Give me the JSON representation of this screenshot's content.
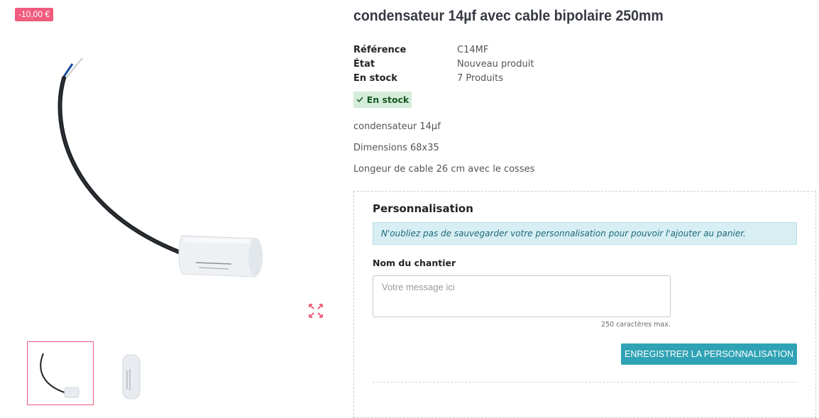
{
  "product": {
    "discount_badge": "-10,00 €",
    "title": "condensateur 14µf avec cable bipolaire 250mm"
  },
  "specs": [
    {
      "label": "Référence",
      "value": "C14MF"
    },
    {
      "label": "État",
      "value": "Nouveau produit"
    },
    {
      "label": "En stock",
      "value": "7 Produits"
    }
  ],
  "stock_status": "En stock",
  "description": [
    "condensateur 14µf",
    "Dimensions 68x35",
    "Longeur de cable 26 cm avec le cosses"
  ],
  "personalization": {
    "title": "Personnalisation",
    "notice": "N'oubliez pas de sauvegarder votre personnalisation pour pouvoir l'ajouter au panier.",
    "field_label": "Nom du chantier",
    "placeholder": "Votre message ici",
    "char_limit": "250 caractères max.",
    "save_button": "Enregistrer la personnalisation"
  },
  "icons": {
    "expand": "expand-icon",
    "check": "check-icon"
  },
  "colors": {
    "badge": "#f15c7e",
    "button": "#2fa3b5",
    "stock_bg": "#d4edda",
    "alert_bg": "#d7eef3"
  }
}
